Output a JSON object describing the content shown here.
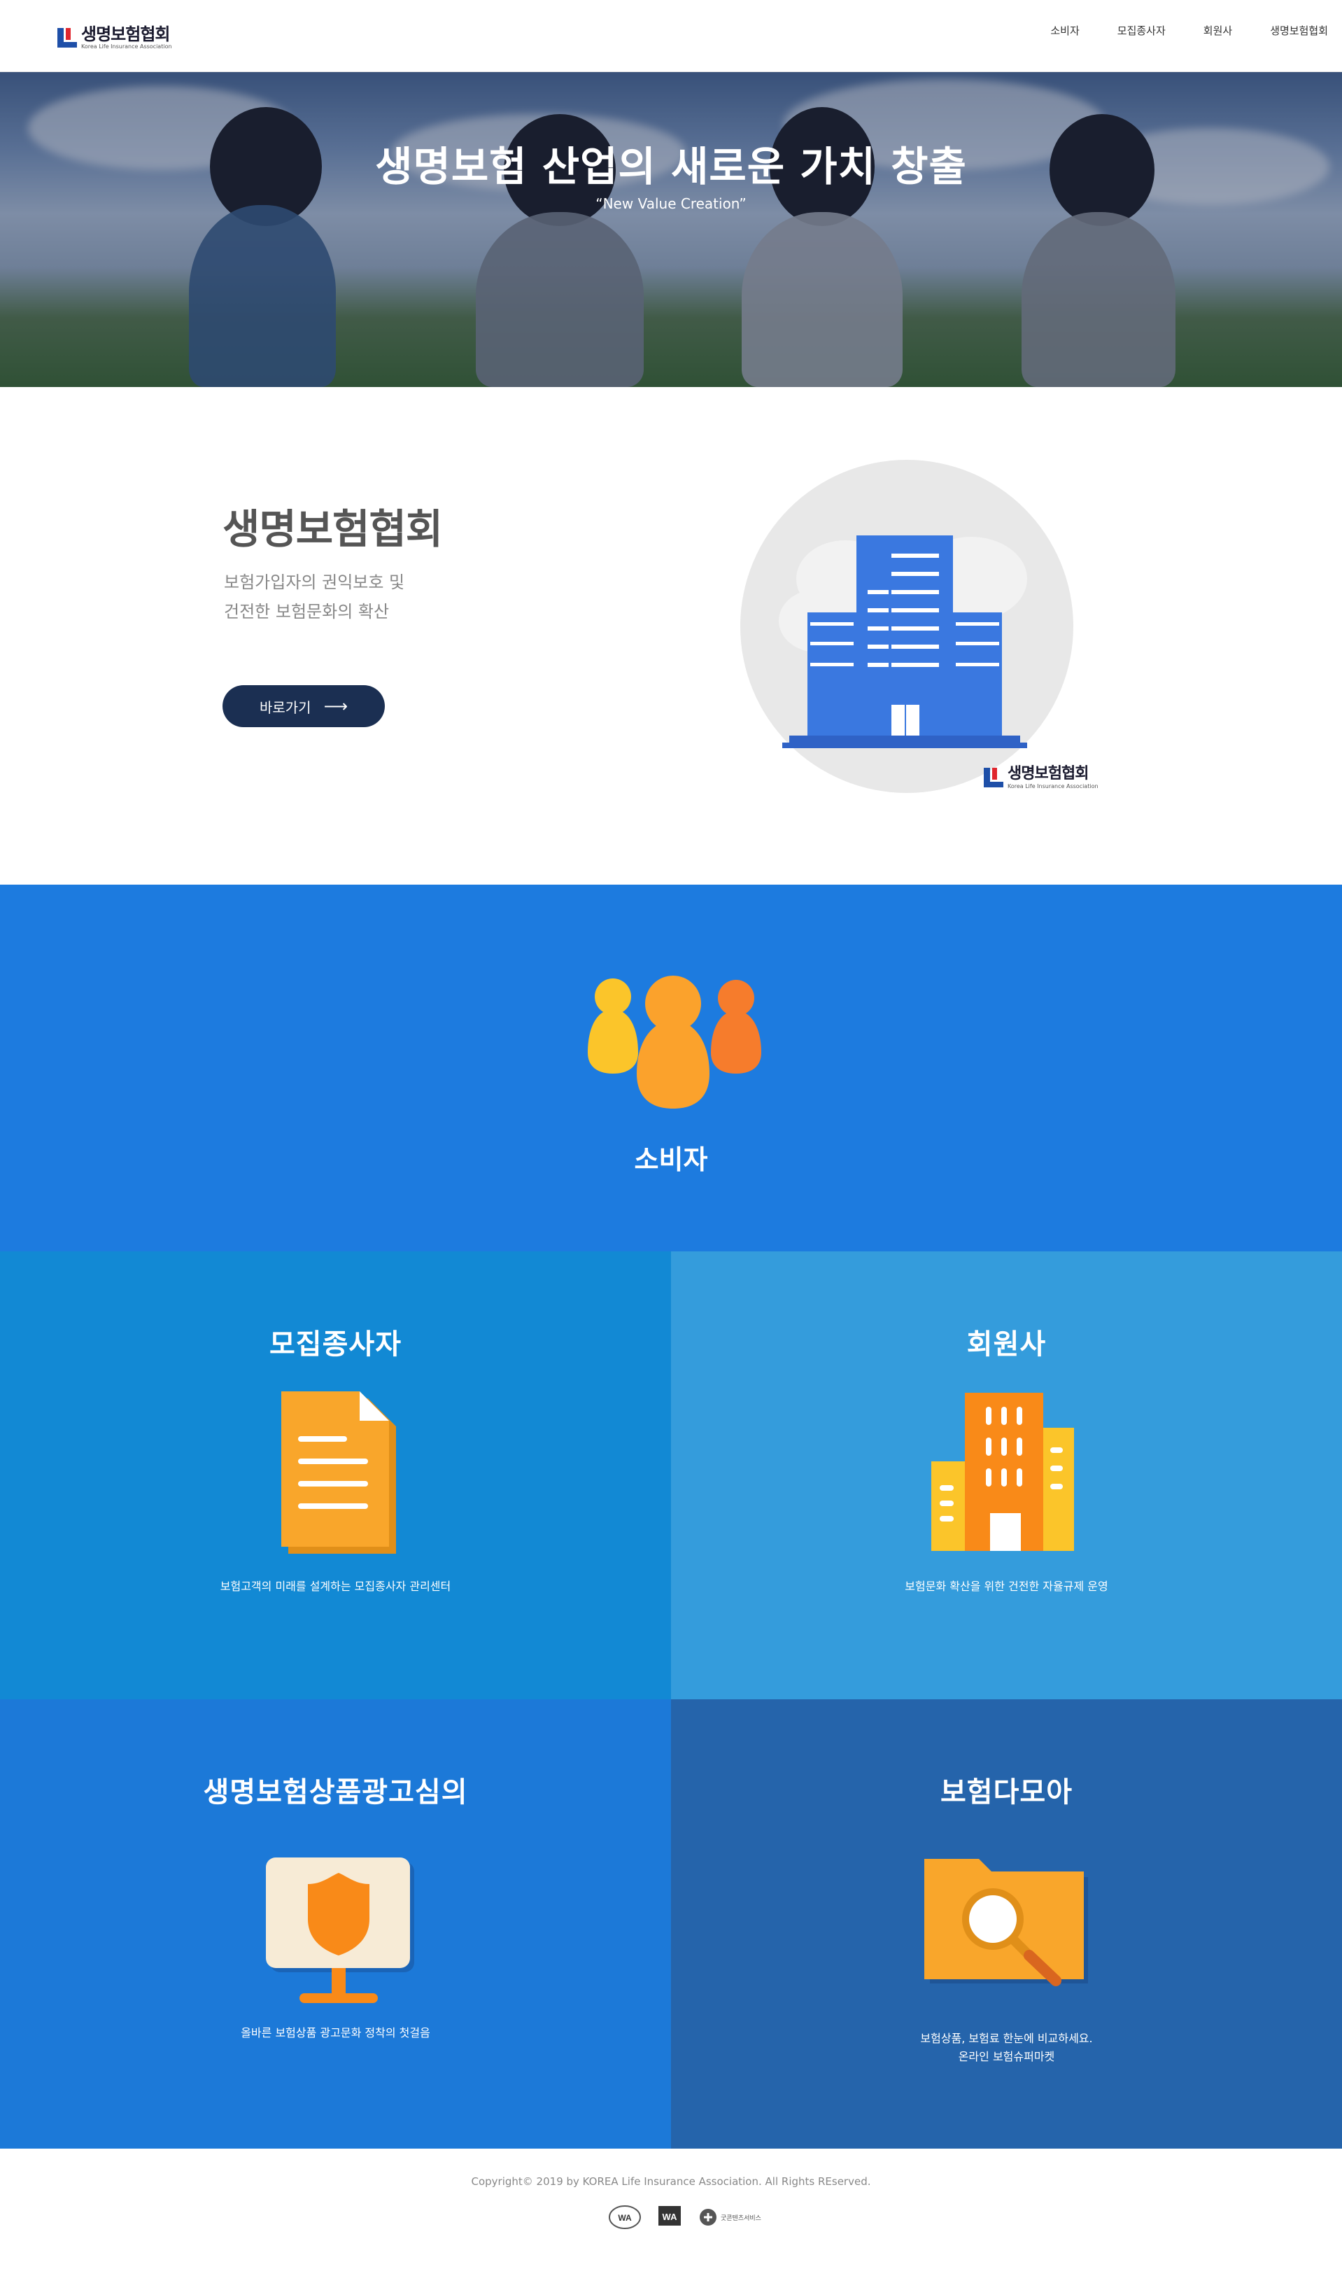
{
  "header": {
    "logo_ko": "생명보험협회",
    "logo_en": "Korea Life Insurance Association",
    "nav": [
      "소비자",
      "모집종사자",
      "회원사",
      "생명보험협회"
    ]
  },
  "hero": {
    "title": "생명보험 산업의 새로운 가치 창출",
    "subtitle": "“New Value Creation”"
  },
  "intro": {
    "title": "생명보험협회",
    "desc_line1": "보험가입자의 권익보호 및",
    "desc_line2": "건전한 보험문화의 확산",
    "button_label": "바로가기",
    "button_arrow": "⟶",
    "logo_ko": "생명보험협회",
    "logo_en": "Korea Life Insurance Association"
  },
  "consumer": {
    "title": "소비자"
  },
  "sections": {
    "recruiter": {
      "title": "모집종사자",
      "desc": "보험고객의 미래를 설계하는 모집종사자 관리센터"
    },
    "member": {
      "title": "회원사",
      "desc": "보험문화 확산을 위한 건전한 자율규제 운영"
    },
    "ad_review": {
      "title": "생명보험상품광고심의",
      "desc": "올바른 보험상품 광고문화 정착의 첫걸음"
    },
    "damoa": {
      "title": "보험다모아",
      "desc_line1": "보험상품, 보험료 한눈에 비교하세요.",
      "desc_line2": "온라인 보험슈퍼마켓"
    }
  },
  "footer": {
    "copyright": "Copyright© 2019 by KOREA Life Insurance Association. All Rights REserved.",
    "cert_labels": [
      "WA",
      "WA",
      "굿콘텐츠서비스"
    ]
  },
  "colors": {
    "consumer_bg": "#1d7bdf",
    "recruiter_bg": "#1289d4",
    "member_bg": "#349cdc",
    "ad_bg": "#1c79d8",
    "damoa_bg": "#2564ab",
    "button_bg": "#1b2f52",
    "accent_orange": "#f9a62b"
  }
}
